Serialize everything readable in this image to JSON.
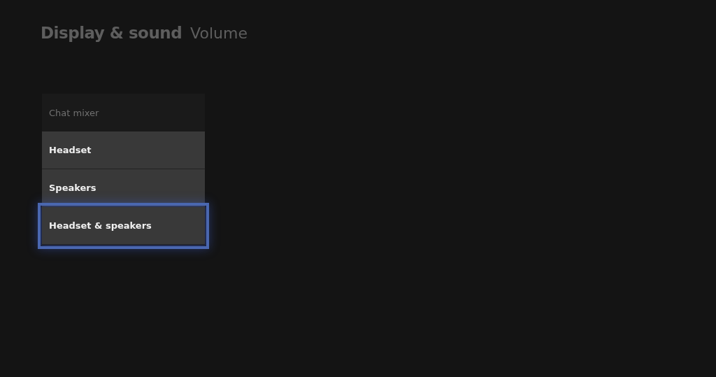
{
  "header": {
    "section": "Display & sound",
    "page": "Volume"
  },
  "dropdown": {
    "label": "Chat mixer",
    "options": [
      {
        "label": "Headset",
        "selected": false
      },
      {
        "label": "Speakers",
        "selected": false
      },
      {
        "label": "Headset & speakers",
        "selected": true
      }
    ]
  }
}
